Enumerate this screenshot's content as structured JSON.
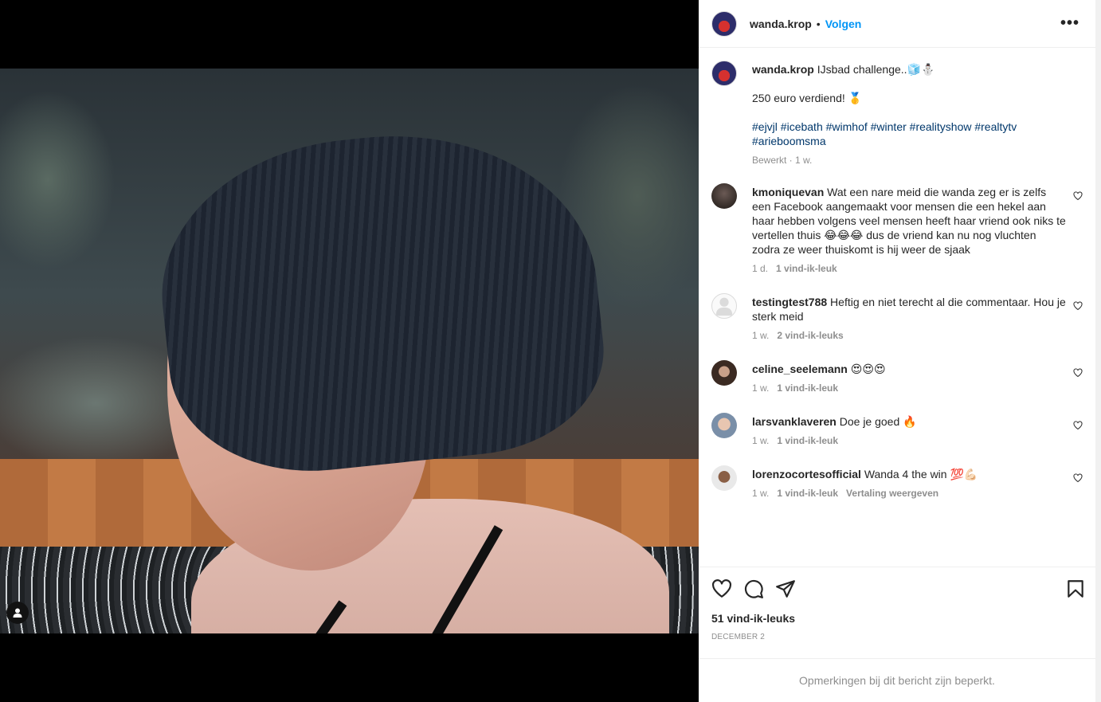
{
  "header": {
    "username": "wanda.krop",
    "separator": "•",
    "follow_label": "Volgen",
    "more_label": "•••"
  },
  "caption": {
    "username": "wanda.krop",
    "text_line1": "IJsbad challenge..🧊⛄",
    "text_line2": "250 euro verdiend! 🥇",
    "hashtags": "#ejvjl #icebath #wimhof #winter #realityshow #realtytv #arieboomsma",
    "meta": "Bewerkt · 1 w."
  },
  "comments": [
    {
      "username": "kmoniquevan",
      "text": "Wat een nare meid die wanda zeg er is zelfs een Facebook aangemaakt voor mensen die een hekel aan haar hebben volgens veel mensen heeft haar vriend ook niks te vertellen thuis 😂😂😂 dus de vriend kan nu nog vluchten zodra ze weer thuiskomt is hij weer de sjaak",
      "time": "1 d.",
      "likes": "1 vind-ik-leuk",
      "extra": ""
    },
    {
      "username": "testingtest788",
      "text": "Heftig en niet terecht al die commentaar. Hou je sterk meid",
      "time": "1 w.",
      "likes": "2 vind-ik-leuks",
      "extra": ""
    },
    {
      "username": "celine_seelemann",
      "text": "😍😍😍",
      "time": "1 w.",
      "likes": "1 vind-ik-leuk",
      "extra": ""
    },
    {
      "username": "larsvanklaveren",
      "text": "Doe je goed 🔥",
      "time": "1 w.",
      "likes": "1 vind-ik-leuk",
      "extra": ""
    },
    {
      "username": "lorenzocortesofficial",
      "text": "Wanda 4 the win 💯💪🏻",
      "time": "1 w.",
      "likes": "1 vind-ik-leuk",
      "extra": "Vertaling weergeven"
    }
  ],
  "actions": {
    "likes": "51 vind-ik-leuks",
    "date": "DECEMBER 2"
  },
  "footer": {
    "text": "Opmerkingen bij dit bericht zijn beperkt."
  },
  "icons": {
    "like": "heart-icon",
    "comment": "comment-icon",
    "share": "share-icon",
    "save": "bookmark-icon",
    "tag": "user-tag-icon"
  }
}
